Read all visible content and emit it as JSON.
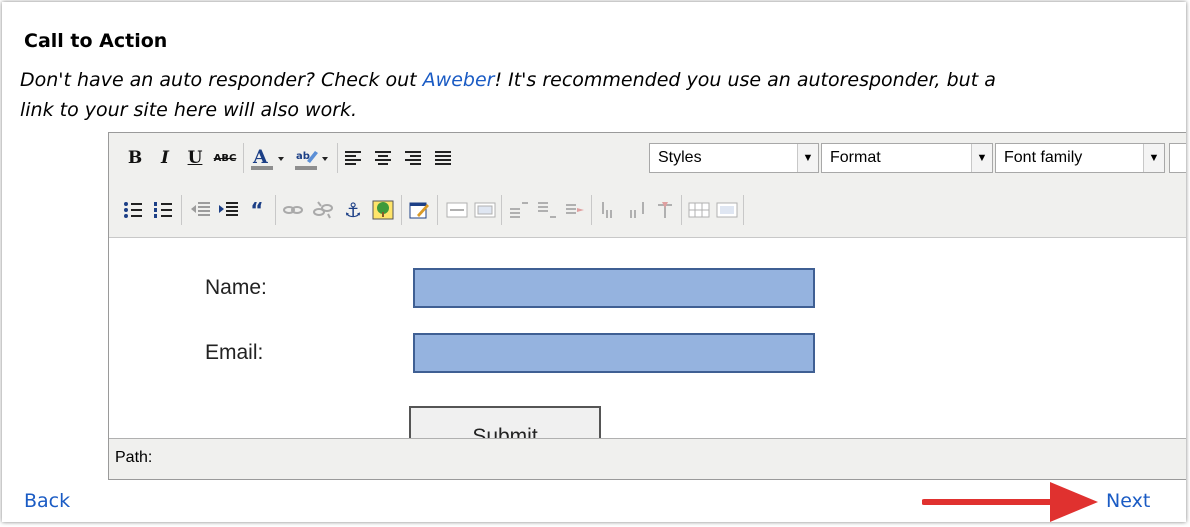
{
  "section": {
    "title": "Call to Action",
    "desc_part1": "Don't have an auto responder? Check out ",
    "desc_link": "Aweber",
    "desc_part2": "! It's recommended you use an autoresponder, but a",
    "desc_line2": "link to your site here will also work."
  },
  "toolbar": {
    "row1": {
      "bold": "B",
      "italic": "I",
      "underline": "U",
      "strike": "ABC",
      "styles_label": "Styles",
      "format_label": "Format",
      "fontfamily_label": "Font family"
    }
  },
  "form": {
    "name_label": "Name:",
    "email_label": "Email:",
    "submit_label": "Submit"
  },
  "status": {
    "path_label": "Path:"
  },
  "nav": {
    "back_label": "Back",
    "next_label": "Next"
  },
  "colors": {
    "accent": "#1a5bc4",
    "input_fill": "#95b3df",
    "arrow": "#e0312f"
  }
}
